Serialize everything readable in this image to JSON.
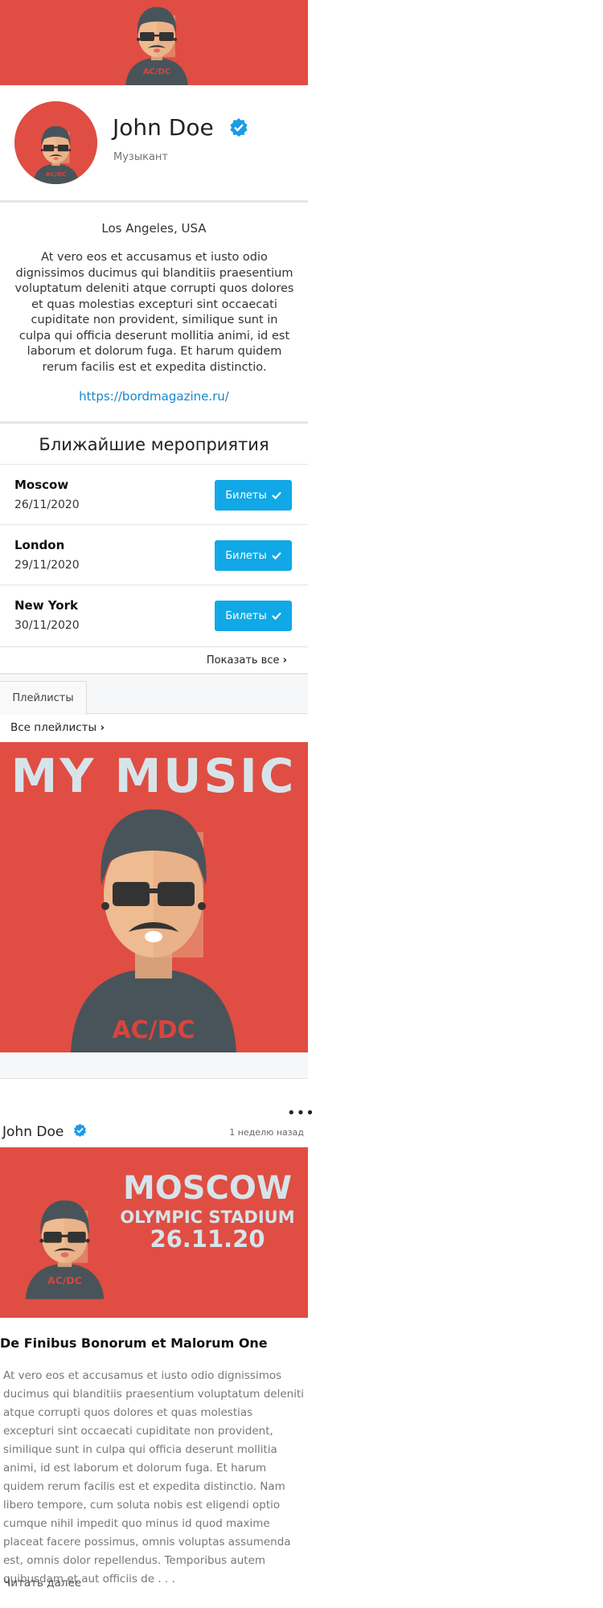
{
  "profile": {
    "name": "John Doe",
    "role": "Музыкант",
    "location": "Los Angeles, USA",
    "bio": "At vero eos et accusamus et iusto odio dignissimos ducimus qui blanditiis praesentium voluptatum deleniti atque corrupti quos dolores et quas molestias excepturi sint occaecati cupiditate non provident, similique sunt in culpa qui officia deserunt mollitia animi, id est laborum et dolorum fuga. Et harum quidem rerum facilis est et expedita distinctio.",
    "website": "https://bordmagazine.ru/"
  },
  "events": {
    "title": "Ближайшие мероприятия",
    "items": [
      {
        "city": "Moscow",
        "date": "26/11/2020",
        "button": "Билеты"
      },
      {
        "city": "London",
        "date": "29/11/2020",
        "button": "Билеты"
      },
      {
        "city": "New York",
        "date": "30/11/2020",
        "button": "Билеты"
      }
    ],
    "show_all": "Показать все"
  },
  "playlists": {
    "tab": "Плейлисты",
    "all_link": "Все плейлисты",
    "cover_text": "MY MUSIC",
    "shirt_text": "AC/DC"
  },
  "post": {
    "author": "John Doe",
    "time": "1 неделю назад",
    "image_text": {
      "line1": "MOSCOW",
      "line2": "OLYMPIC STADIUM",
      "line3": "26.11.20"
    },
    "title": "De Finibus Bonorum et Malorum One",
    "body": "At vero eos et accusamus et iusto odio dignissimos ducimus qui blanditiis praesentium voluptatum deleniti atque corrupti quos dolores et quas molestias excepturi sint occaecati cupiditate non provident, similique sunt in culpa qui officia deserunt mollitia animi, id est laborum et dolorum fuga. Et harum quidem rerum facilis est et expedita distinctio. Nam libero tempore, cum soluta nobis est eligendi optio cumque nihil impedit quo minus id quod maxime placeat facere possimus, omnis voluptas assumenda est, omnis dolor repellendus. Temporibus autem quibusdam et aut officiis de . . .",
    "read_more": "Читать далее"
  },
  "colors": {
    "brand_red": "#e04d43",
    "accent_blue": "#10a8e6",
    "link_blue": "#1a86c8",
    "verified_blue": "#1a9be6"
  }
}
